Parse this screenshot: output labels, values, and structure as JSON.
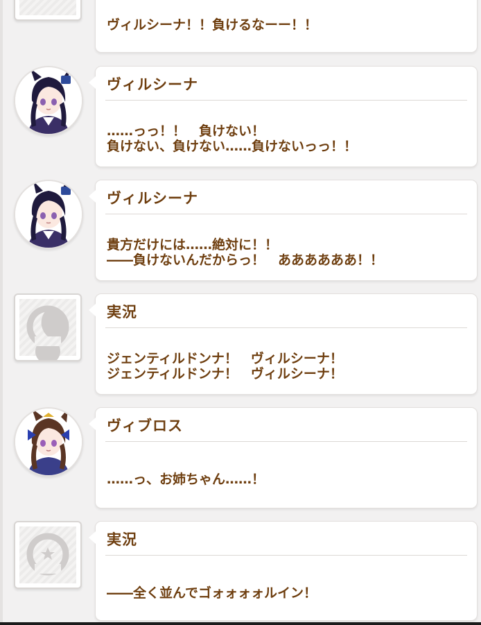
{
  "colors": {
    "text": "#6e3e0f",
    "bubble": "#ffffff",
    "background": "#f2f1f1",
    "placeholder_icon": "#c9c6c4"
  },
  "messages": [
    {
      "speaker": "",
      "avatar": "placeholder-avatar",
      "lines": [
        "ヴィルシーナ！！負けるなーー！！"
      ]
    },
    {
      "speaker": "ヴィルシーナ",
      "avatar": "vivlos-sister-avatar",
      "lines": [
        "……っっ！！　負けない！",
        "負けない、負けない……負けないっっ！！"
      ]
    },
    {
      "speaker": "ヴィルシーナ",
      "avatar": "verxina-avatar",
      "lines": [
        "貴方だけには……絶対に！！",
        "――負けないんだからっ！　ああああああ！！"
      ]
    },
    {
      "speaker": "実況",
      "avatar": "placeholder-avatar",
      "lines": [
        "ジェンティルドンナ！　ヴィルシーナ！",
        "ジェンティルドンナ！　ヴィルシーナ！"
      ]
    },
    {
      "speaker": "ヴィブロス",
      "avatar": "vivlos-avatar",
      "lines": [
        "……っ、お姉ちゃん……！"
      ]
    },
    {
      "speaker": "実況",
      "avatar": "placeholder-avatar",
      "lines": [
        "――全く並んでゴォォォォルイン！"
      ]
    }
  ]
}
